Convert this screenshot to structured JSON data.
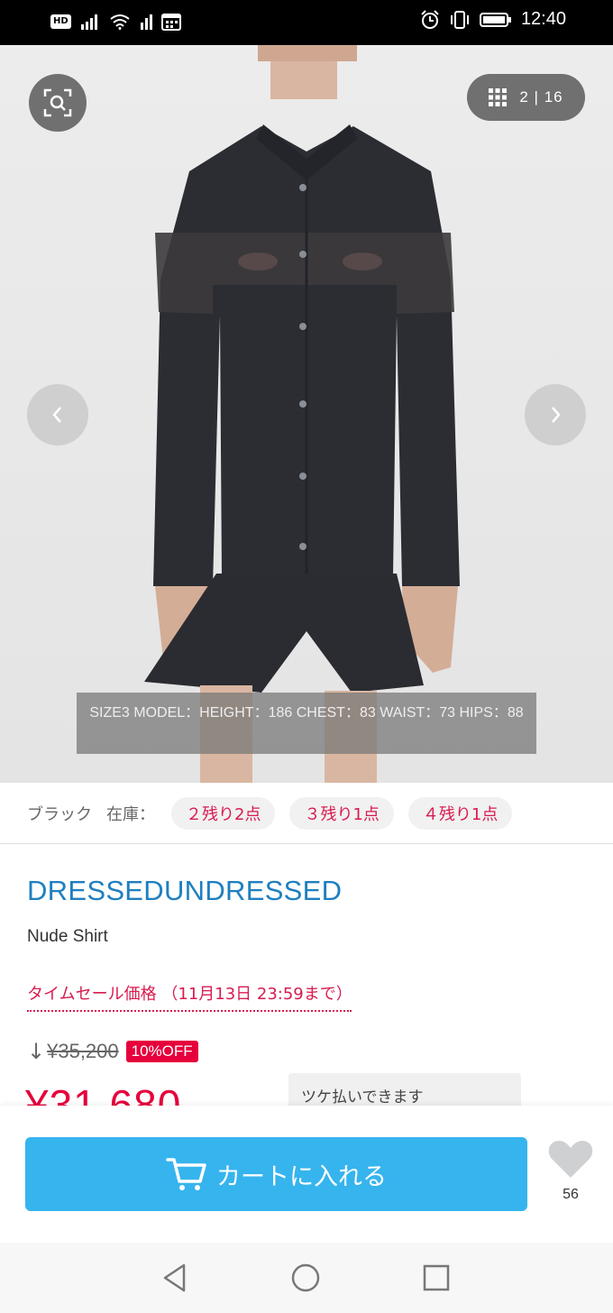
{
  "status_bar": {
    "network_badge": "HD",
    "time": "12:40",
    "icons": [
      "signal-icon",
      "wifi-icon",
      "signal2-icon",
      "calendar-icon",
      "alarm-icon",
      "vibrate-icon",
      "battery-icon"
    ]
  },
  "gallery": {
    "counter": "2 | 16",
    "model_caption": "SIZE3 MODEL：HEIGHT：186 CHEST：83 WAIST：73 HIPS：88"
  },
  "stock": {
    "color": "ブラック",
    "label": "在庫：",
    "chips": [
      "２残り2点",
      "３残り1点",
      "４残り1点"
    ]
  },
  "product": {
    "brand": "DRESSEDUNDRESSED",
    "name": "Nude Shirt",
    "sale_label": "タイムセール価格 （11月13日 23:59まで）",
    "arrow": "↓",
    "original_price": "¥35,200",
    "discount_badge": "10%OFF",
    "sale_price": "¥31,680",
    "payment_note": "ツケ払いできます"
  },
  "actions": {
    "cart_label": "カートに入れる",
    "favorite_count": "56"
  },
  "colors": {
    "brand_blue": "#1f7fc0",
    "cart_blue": "#36b4ee",
    "sale_red": "#e6003c",
    "chip_text": "#d81b4f"
  }
}
